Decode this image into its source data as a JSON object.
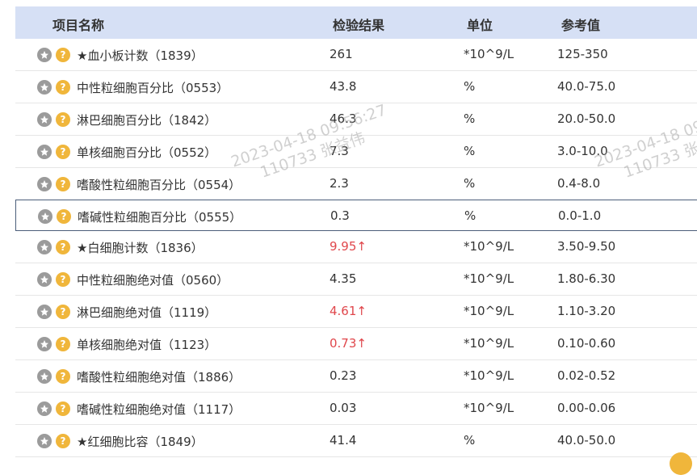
{
  "header": {
    "name": "项目名称",
    "result": "检验结果",
    "unit": "单位",
    "ref": "参考值"
  },
  "rows": [
    {
      "name": "★血小板计数（1839）",
      "result": "261",
      "flag": "",
      "unit": "*10^9/L",
      "ref": "125-350"
    },
    {
      "name": "中性粒细胞百分比（0553）",
      "result": "43.8",
      "flag": "",
      "unit": "%",
      "ref": "40.0-75.0"
    },
    {
      "name": "淋巴细胞百分比（1842）",
      "result": "46.3",
      "flag": "",
      "unit": "%",
      "ref": "20.0-50.0"
    },
    {
      "name": "单核细胞百分比（0552）",
      "result": "7.3",
      "flag": "",
      "unit": "%",
      "ref": "3.0-10.0"
    },
    {
      "name": "嗜酸性粒细胞百分比（0554）",
      "result": "2.3",
      "flag": "",
      "unit": "%",
      "ref": "0.4-8.0"
    },
    {
      "name": "嗜碱性粒细胞百分比（0555）",
      "result": "0.3",
      "flag": "",
      "unit": "%",
      "ref": "0.0-1.0"
    },
    {
      "name": "★白细胞计数（1836）",
      "result": "9.95",
      "flag": "↑",
      "unit": "*10^9/L",
      "ref": "3.50-9.50"
    },
    {
      "name": "中性粒细胞绝对值（0560）",
      "result": "4.35",
      "flag": "",
      "unit": "*10^9/L",
      "ref": "1.80-6.30"
    },
    {
      "name": "淋巴细胞绝对值（1119）",
      "result": "4.61",
      "flag": "↑",
      "unit": "*10^9/L",
      "ref": "1.10-3.20"
    },
    {
      "name": "单核细胞绝对值（1123）",
      "result": "0.73",
      "flag": "↑",
      "unit": "*10^9/L",
      "ref": "0.10-0.60"
    },
    {
      "name": "嗜酸性粒细胞绝对值（1886）",
      "result": "0.23",
      "flag": "",
      "unit": "*10^9/L",
      "ref": "0.02-0.52"
    },
    {
      "name": "嗜碱性粒细胞绝对值（1117）",
      "result": "0.03",
      "flag": "",
      "unit": "*10^9/L",
      "ref": "0.00-0.06"
    },
    {
      "name": "★红细胞比容（1849）",
      "result": "41.4",
      "flag": "",
      "unit": "%",
      "ref": "40.0-50.0"
    }
  ],
  "row_icons": {
    "favorite": "star-icon",
    "help": "question-icon",
    "help_glyph": "?"
  },
  "watermark": {
    "line1": "2023-04-18 09:56:27",
    "line2": "110733 张益伟"
  },
  "colors": {
    "header_bg": "#d6e0f5",
    "abnormal": "#e0474c",
    "help_icon": "#f0b63b",
    "star_icon": "#9b9b9b"
  }
}
